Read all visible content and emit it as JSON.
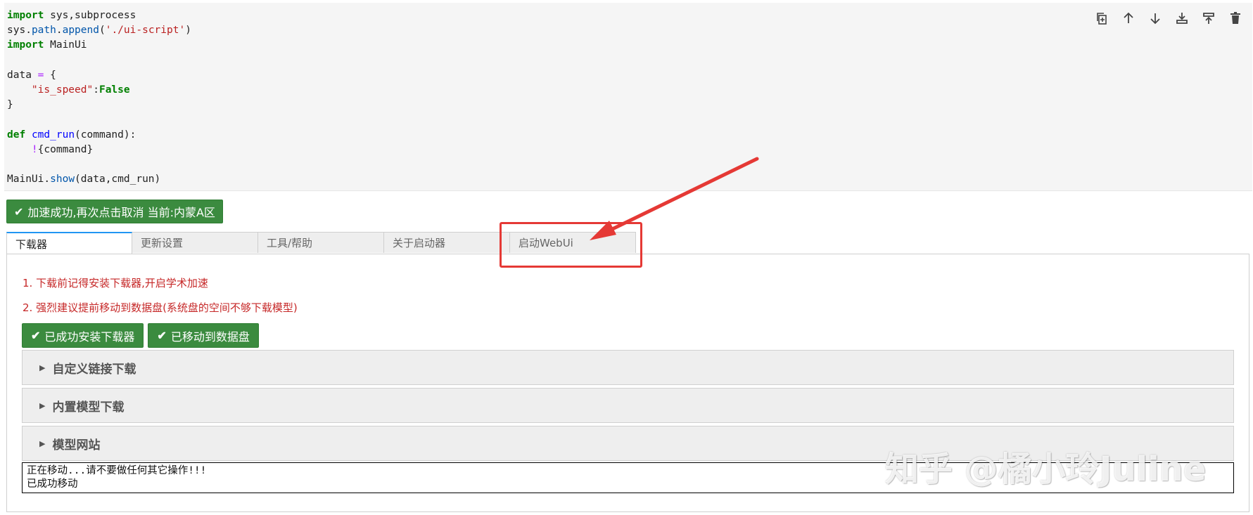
{
  "code": {
    "lines": [
      [
        {
          "t": "import",
          "c": "kw"
        },
        {
          "t": " sys,subprocess",
          "c": ""
        }
      ],
      [
        {
          "t": "sys",
          "c": ""
        },
        {
          "t": ".",
          "c": ""
        },
        {
          "t": "path",
          "c": "attr"
        },
        {
          "t": ".",
          "c": ""
        },
        {
          "t": "append",
          "c": "attr"
        },
        {
          "t": "(",
          "c": ""
        },
        {
          "t": "'./ui-script'",
          "c": "str"
        },
        {
          "t": ")",
          "c": ""
        }
      ],
      [
        {
          "t": "import",
          "c": "kw"
        },
        {
          "t": " MainUi",
          "c": ""
        }
      ],
      [],
      [
        {
          "t": "data ",
          "c": ""
        },
        {
          "t": "=",
          "c": "op"
        },
        {
          "t": " {",
          "c": ""
        }
      ],
      [
        {
          "t": "    ",
          "c": ""
        },
        {
          "t": "\"is_speed\"",
          "c": "str"
        },
        {
          "t": ":",
          "c": ""
        },
        {
          "t": "False",
          "c": "kw"
        }
      ],
      [
        {
          "t": "}",
          "c": ""
        }
      ],
      [],
      [
        {
          "t": "def",
          "c": "kw"
        },
        {
          "t": " ",
          "c": ""
        },
        {
          "t": "cmd_run",
          "c": "fn"
        },
        {
          "t": "(command):",
          "c": ""
        }
      ],
      [
        {
          "t": "    ",
          "c": ""
        },
        {
          "t": "!",
          "c": "op"
        },
        {
          "t": "{command}",
          "c": ""
        }
      ],
      [],
      [
        {
          "t": "MainUi",
          "c": ""
        },
        {
          "t": ".",
          "c": ""
        },
        {
          "t": "show",
          "c": "attr"
        },
        {
          "t": "(data,cmd_run)",
          "c": ""
        }
      ]
    ]
  },
  "toolbar": {
    "icons": [
      "copy-icon",
      "arrow-up-icon",
      "arrow-down-icon",
      "insert-below-icon",
      "insert-above-icon",
      "delete-icon"
    ]
  },
  "speed_button": {
    "label": "加速成功,再次点击取消 当前:内蒙A区"
  },
  "tabs": [
    {
      "label": "下载器",
      "active": true
    },
    {
      "label": "更新设置",
      "active": false
    },
    {
      "label": "工具/帮助",
      "active": false
    },
    {
      "label": "关于启动器",
      "active": false
    },
    {
      "label": "启动WebUi",
      "active": false
    }
  ],
  "panel": {
    "note1": "1. 下载前记得安装下载器,开启学术加速",
    "note2": "2. 强烈建议提前移动到数据盘(系统盘的空间不够下载模型)",
    "btn_installed": "已成功安装下载器",
    "btn_moved": "已移动到数据盘",
    "accordions": [
      "自定义链接下载",
      "内置模型下载",
      "模型网站"
    ],
    "output": "正在移动...请不要做任何其它操作!!!\n已成功移动"
  },
  "watermark": "知乎 @橘小玲Juline",
  "colors": {
    "accent_green": "#3b8b3f",
    "note_red": "#c62828",
    "annotation_red": "#e53935",
    "tab_active_border": "#2196f3"
  }
}
